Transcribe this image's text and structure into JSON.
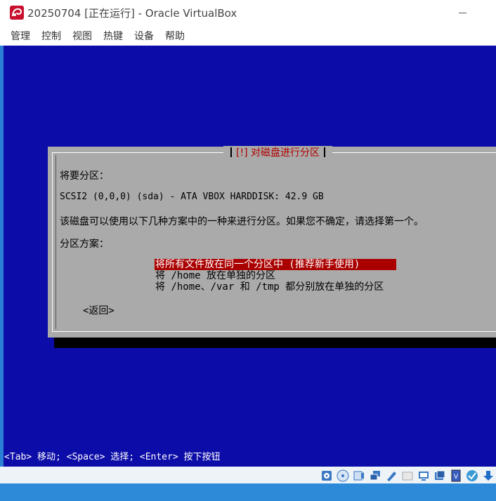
{
  "window": {
    "title": "20250704 [正在运行] - Oracle VirtualBox"
  },
  "menu": {
    "items": [
      "管理",
      "控制",
      "视图",
      "热键",
      "设备",
      "帮助"
    ]
  },
  "dialog": {
    "title": "[!] 对磁盘进行分区",
    "partition_label": "将要分区：",
    "disk": "SCSI2 (0,0,0) (sda) - ATA VBOX HARDDISK: 42.9 GB",
    "description": "该磁盘可以使用以下几种方案中的一种来进行分区。如果您不确定，请选择第一个。",
    "scheme_label": "分区方案：",
    "options": [
      "将所有文件放在同一个分区中 (推荐新手使用)",
      "将 /home 放在单独的分区",
      "将 /home、/var 和 /tmp 都分别放在单独的分区"
    ],
    "selected_index": 0,
    "back_button": "<返回>"
  },
  "hint": "<Tab> 移动; <Space> 选择; <Enter> 按下按钮",
  "status_icons": [
    "hard-disk-icon",
    "optical-drive-icon",
    "audio-icon",
    "network-icon",
    "usb-icon",
    "shared-folders-icon",
    "display-icon",
    "recording-icon",
    "vt-x-icon",
    "guest-additions-icon",
    "host-key-icon"
  ],
  "colors": {
    "vm_background": "#0c0ca8",
    "dialog_background": "#aaaaaa",
    "dialog_title": "#b00000",
    "selection": "#aa0000"
  }
}
